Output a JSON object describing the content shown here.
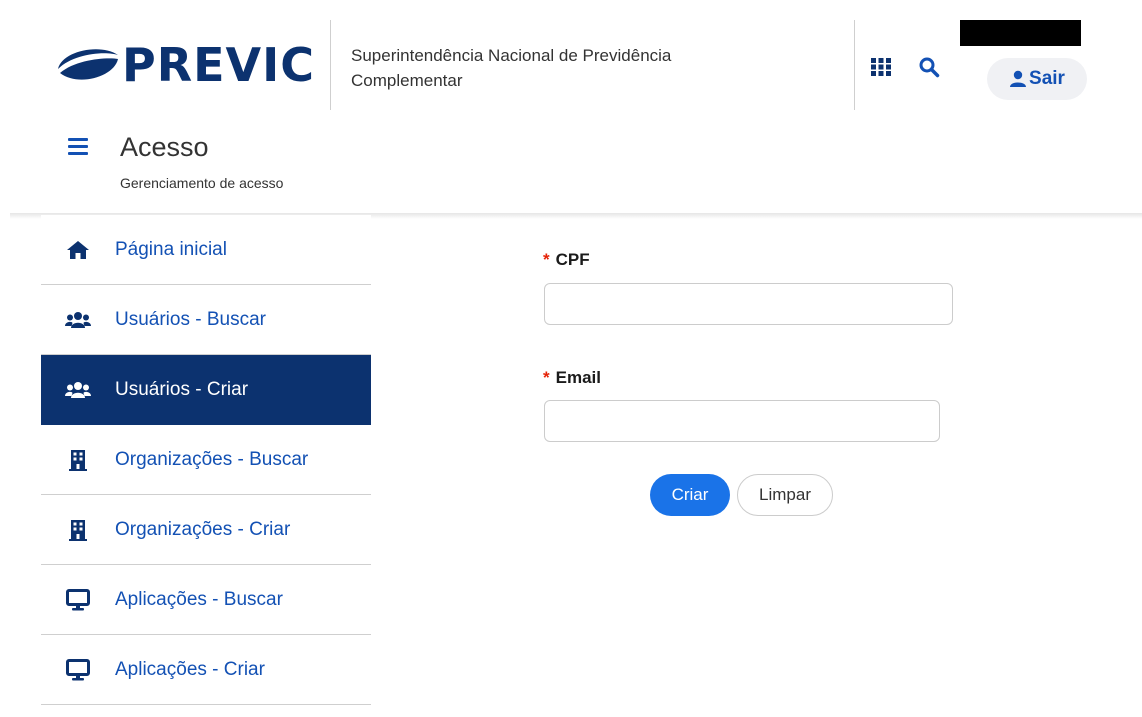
{
  "header": {
    "logo_text": "PREVIC",
    "org_line1": "Superintendência Nacional de Previdência",
    "org_line2": "Complementar",
    "apps_icon": "grid-icon",
    "search_icon": "search-icon",
    "logout_label": "Sair",
    "logout_icon": "user-icon"
  },
  "subheader": {
    "title": "Acesso",
    "subtitle": "Gerenciamento de acesso"
  },
  "sidebar": {
    "items": [
      {
        "label": "Página inicial",
        "icon": "home-icon",
        "active": false
      },
      {
        "label": "Usuários - Buscar",
        "icon": "users-icon",
        "active": false
      },
      {
        "label": "Usuários - Criar",
        "icon": "users-icon",
        "active": true
      },
      {
        "label": "Organizações - Buscar",
        "icon": "building-icon",
        "active": false
      },
      {
        "label": "Organizações - Criar",
        "icon": "building-icon",
        "active": false
      },
      {
        "label": "Aplicações - Buscar",
        "icon": "monitor-icon",
        "active": false
      },
      {
        "label": "Aplicações - Criar",
        "icon": "monitor-icon",
        "active": false
      }
    ]
  },
  "form": {
    "required_marker": "*",
    "cpf_label": "CPF",
    "cpf_value": "",
    "email_label": "Email",
    "email_value": "",
    "submit_label": "Criar",
    "clear_label": "Limpar"
  },
  "colors": {
    "brand_dark": "#0c326f",
    "link_blue": "#1351b4",
    "primary_button": "#1a73e8",
    "required_red": "#e52207"
  }
}
